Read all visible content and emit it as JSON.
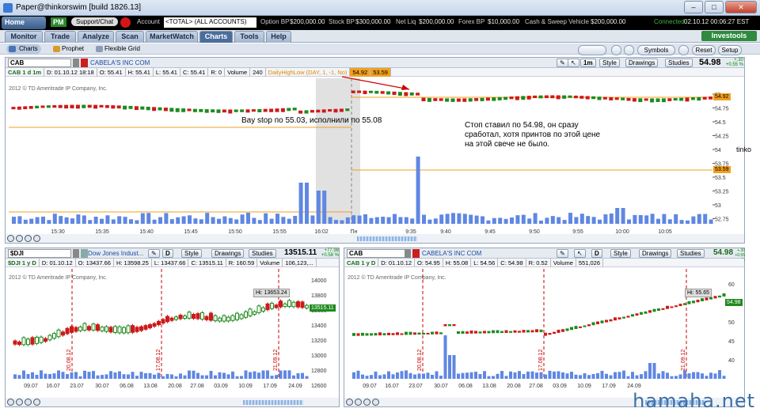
{
  "window": {
    "title": "Paper@thinkorswim [build 1826.13]",
    "controls": {
      "minimize": "–",
      "maximize": "□",
      "close": "✕"
    }
  },
  "account_bar": {
    "home": "Home",
    "pm": "PM",
    "support": "Support/Chat",
    "account_label": "Account",
    "account_value": "<TOTAL> (ALL ACCOUNTS)",
    "option_bp_label": "Option BP",
    "option_bp": "$200,000.00",
    "stock_bp_label": "Stock BP",
    "stock_bp": "$300,000.00",
    "net_liq_label": "Net Liq",
    "net_liq": "$200,000.00",
    "forex_bp_label": "Forex BP",
    "forex_bp": "$10,000.00",
    "cash_label": "Cash & Sweep Vehicle",
    "cash": "$200,000.00",
    "status": "Connected",
    "datetime": "02.10.12 00:06:27 EST"
  },
  "tabs": [
    "Monitor",
    "Trade",
    "Analyze",
    "Scan",
    "MarketWatch",
    "Charts",
    "Tools",
    "Help"
  ],
  "active_tab": "Charts",
  "investools": "Investools",
  "subtabs": [
    "Charts",
    "Prophet",
    "Flexible Grid"
  ],
  "right_buttons": {
    "symbols": "Symbols",
    "reset": "Reset",
    "setup": "Setup"
  },
  "main_chart": {
    "symbol": "CAB",
    "name": "CABELA'S INC COM",
    "period": "1m",
    "style": "Style",
    "drawings": "Drawings",
    "studies": "Studies",
    "last": "54.98",
    "chg": "+.30",
    "chg_pct": "+0.55 %",
    "ohlc": [
      "CAB 1 d 1m",
      "D: 01.10.12 18:18",
      "O: 55.41",
      "H: 55.41",
      "L: 55.41",
      "C: 55.41",
      "R: 0",
      "Volume",
      "240",
      "DailyHighLow (DAY, 1, -1, No)",
      "54.92",
      "53.59"
    ],
    "copyright": "2012 © TD Ameritrade IP Company, Inc.",
    "yaxis": [
      "55",
      "54.75",
      "54.5",
      "54.25",
      "54",
      "53.75",
      "53.5",
      "53.25",
      "53",
      "52.75"
    ],
    "xaxis": [
      "15:30",
      "15:35",
      "15:40",
      "15:45",
      "15:50",
      "15:55",
      "16:02",
      "Пн",
      "9:35",
      "9:40",
      "9:45",
      "9:50",
      "9:55",
      "10:00",
      "10:05"
    ],
    "price_labels": [
      "54.92",
      "53.59"
    ],
    "annotation1": "Bay stop по 55.03, исполнили по 55.08",
    "annotation2": "Стоп ставил по 54.98, он сразу сработал, хотя принтов по этой цене на этой свече не было.",
    "side_text": "tinko"
  },
  "dji_chart": {
    "symbol": "$DJI",
    "name": "Dow Jones Indust...",
    "period": "D",
    "style": "Style",
    "drawings": "Drawings",
    "studies": "Studies",
    "last": "13515.11",
    "chg": "+77.98",
    "chg_pct": "+0.58 %",
    "ohlc": [
      "$DJI 1 y D",
      "D: 01.10.12",
      "O: 13437.66",
      "H: 13598.25",
      "L: 13437.66",
      "C: 13515.11",
      "R: 160.59",
      "Volume",
      "106,123,..."
    ],
    "copyright": "2012 © TD Ameritrade IP Company, Inc.",
    "yaxis": [
      "14000",
      "13800",
      "13600",
      "13400",
      "13200",
      "13000",
      "12800",
      "12600"
    ],
    "xaxis": [
      "09.07",
      "16.07",
      "23.07",
      "30.07",
      "06.08",
      "13.08",
      "20.08",
      "27.08",
      "03.09",
      "10.09",
      "17.09",
      "24.09"
    ],
    "hi_label": "Hi: 13653.24",
    "price_label": "13515.11",
    "events": [
      "20.08.12",
      "17.08.12",
      "21.09.12"
    ]
  },
  "cab_chart": {
    "symbol": "CAB",
    "name": "CABELA'S INC COM",
    "period": "D",
    "style": "Style",
    "drawings": "Drawings",
    "studies": "Studies",
    "last": "54.98",
    "chg": "+.30",
    "chg_pct": "+0.55 %",
    "ohlc": [
      "CAB 1 y D",
      "D: 01.10.12",
      "O: 54.95",
      "H: 55.08",
      "L: 54.56",
      "C: 54.98",
      "R: 0.52",
      "Volume",
      "551,026"
    ],
    "copyright": "2012 © TD Ameritrade IP Company, Inc.",
    "yaxis": [
      "60",
      "55",
      "50",
      "45",
      "40"
    ],
    "xaxis": [
      "09.07",
      "16.07",
      "23.07",
      "30.07",
      "06.08",
      "13.08",
      "20.08",
      "27.08",
      "03.09",
      "10.09",
      "17.09",
      "24.09"
    ],
    "hi_label": "Hi: 55.65",
    "price_label": "54.98",
    "events": [
      "20.08.12",
      "17.08.12",
      "21.09.12"
    ]
  },
  "watermark": "hamaha.net",
  "colors": {
    "up": "#1f8a1f",
    "down": "#cc1a1a",
    "volume": "#5f87e3",
    "level": "#f0a020"
  }
}
